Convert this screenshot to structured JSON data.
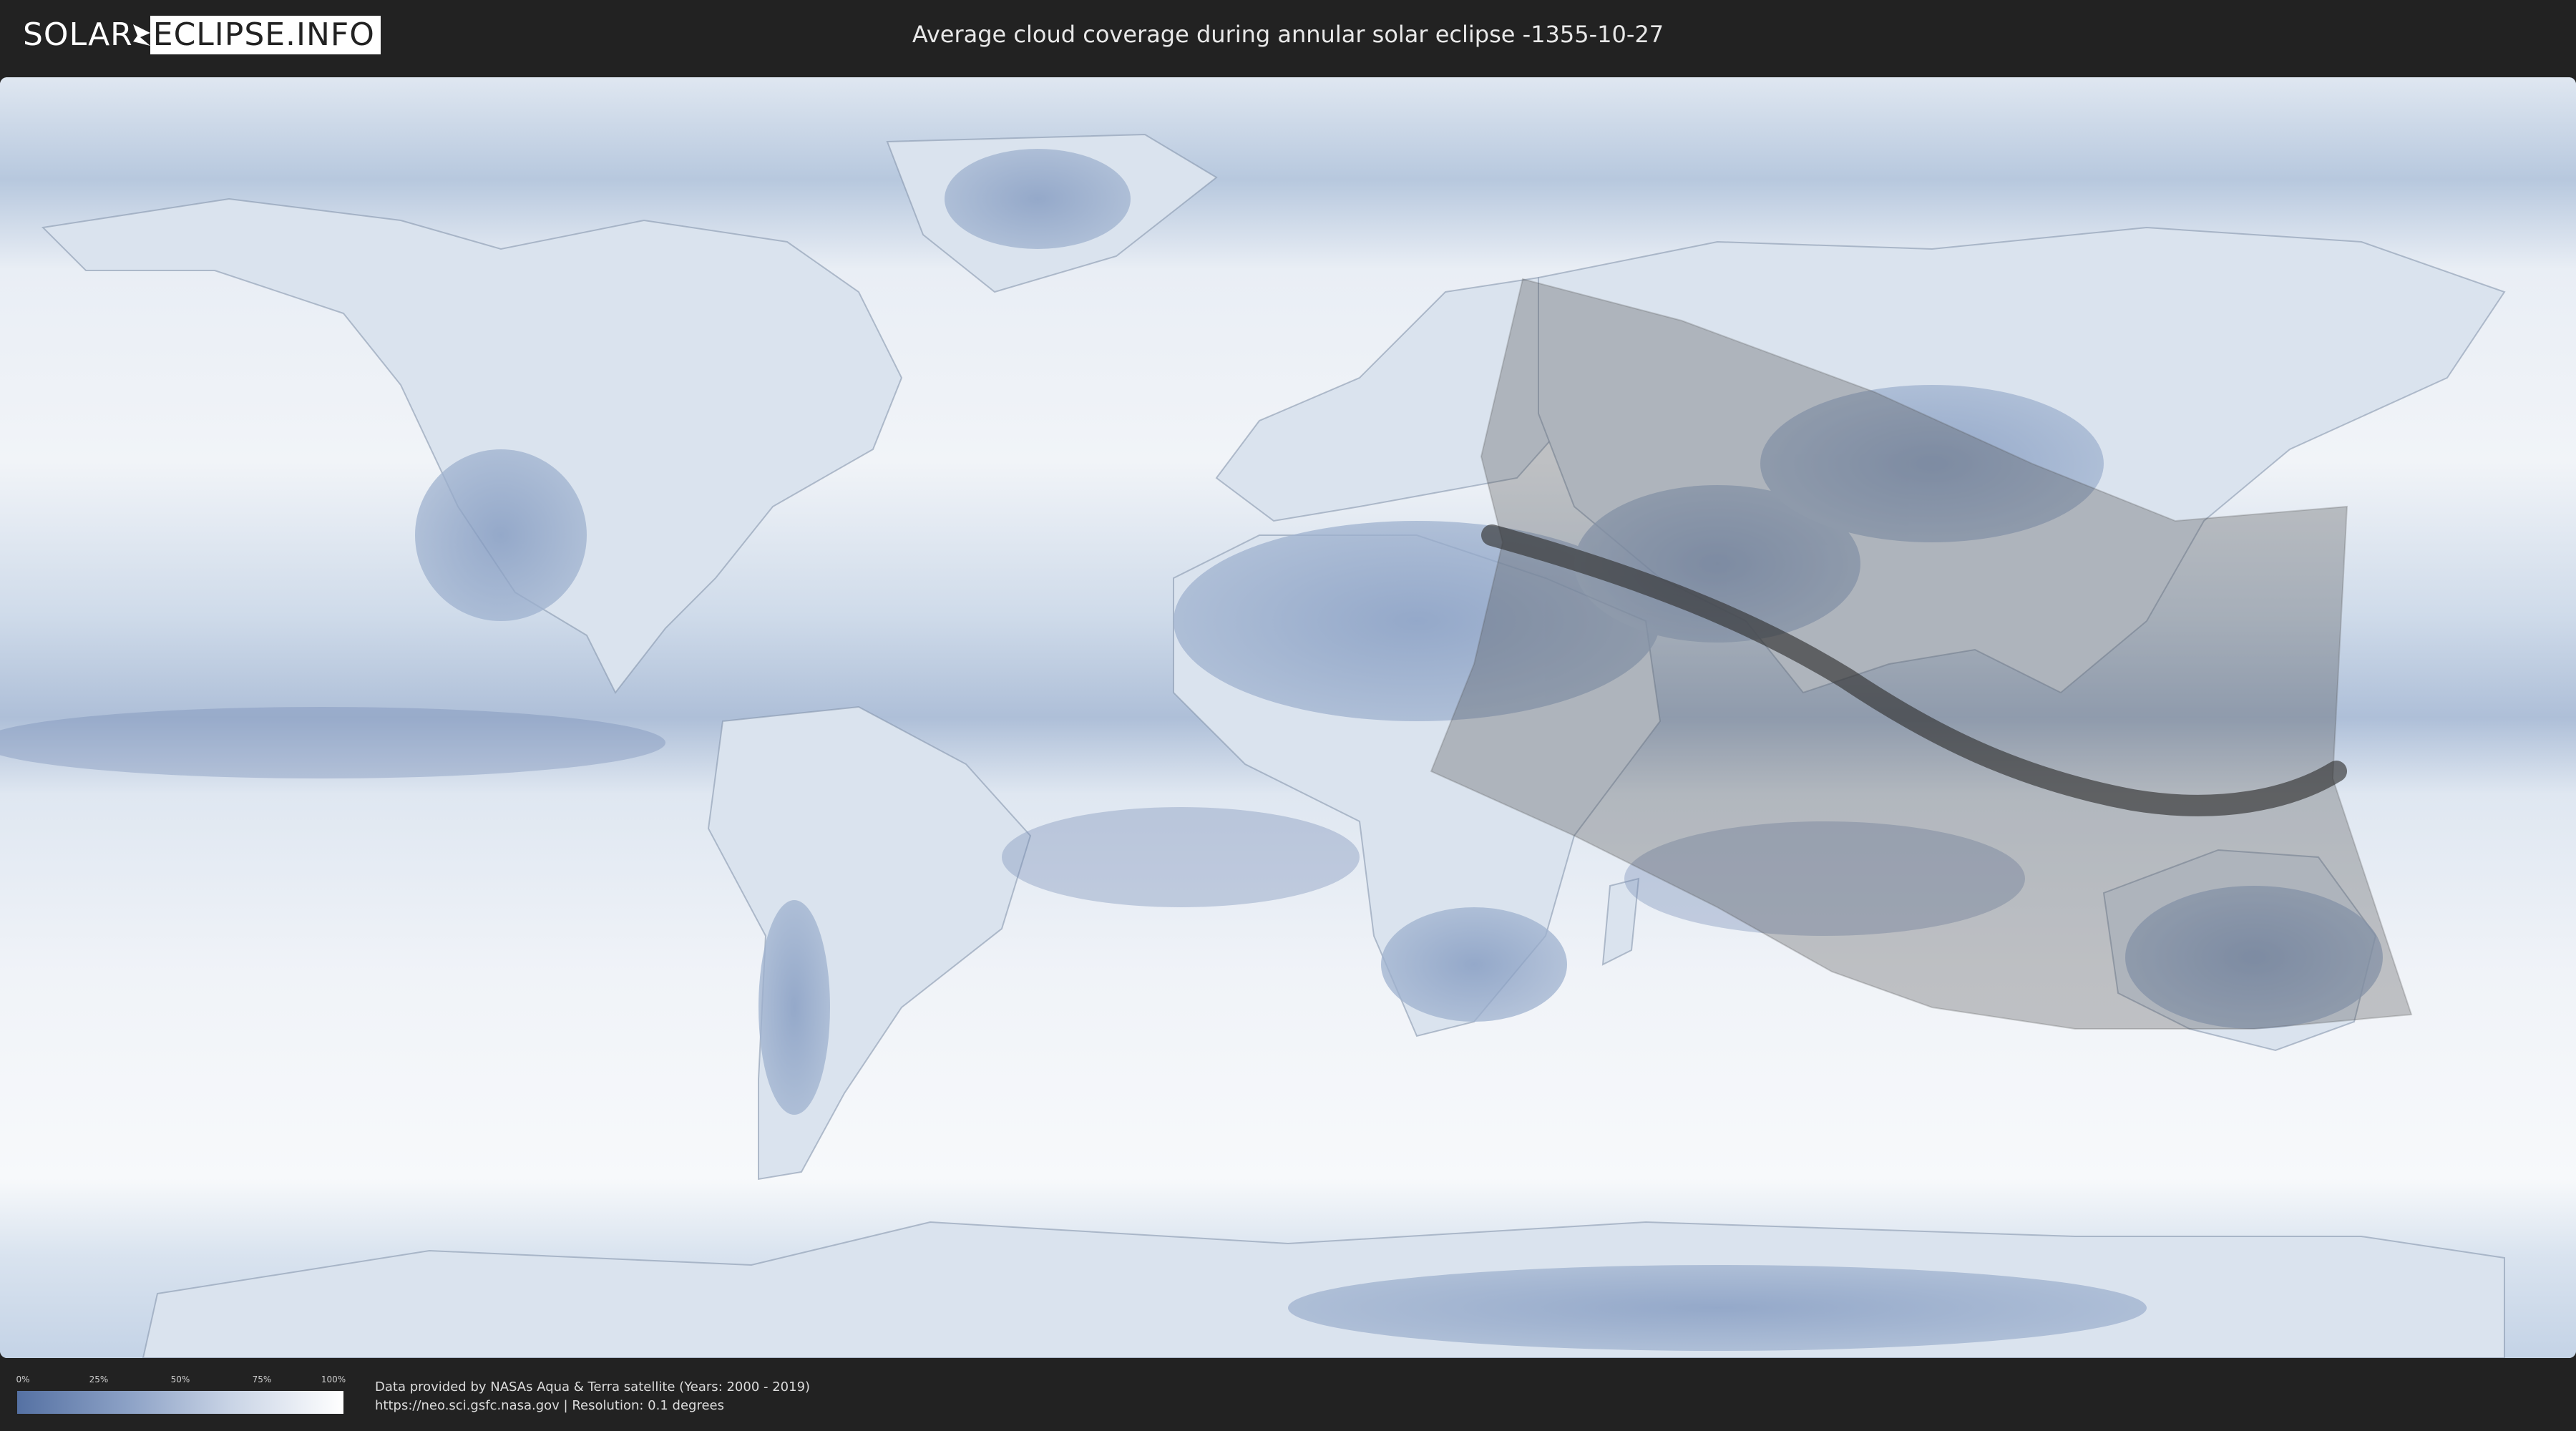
{
  "header": {
    "logo_left": "SOLAR",
    "logo_right": "ECLIPSE.INFO",
    "title": "Average cloud coverage during annular solar eclipse -1355-10-27"
  },
  "map": {
    "projection": "equirectangular",
    "colors": {
      "clear_sky": "#5571a3",
      "full_cloud": "#ffffff",
      "eclipse_shadow": "#4a4a4a",
      "centerline": "#333333"
    }
  },
  "legend": {
    "ticks": [
      "0%",
      "25%",
      "50%",
      "75%",
      "100%"
    ],
    "tick_values": [
      0,
      25,
      50,
      75,
      100
    ]
  },
  "credits": {
    "line1": "Data provided by NASAs Aqua & Terra satellite (Years: 2000 - 2019)",
    "line2": "https://neo.sci.gsfc.nasa.gov | Resolution: 0.1 degrees"
  }
}
